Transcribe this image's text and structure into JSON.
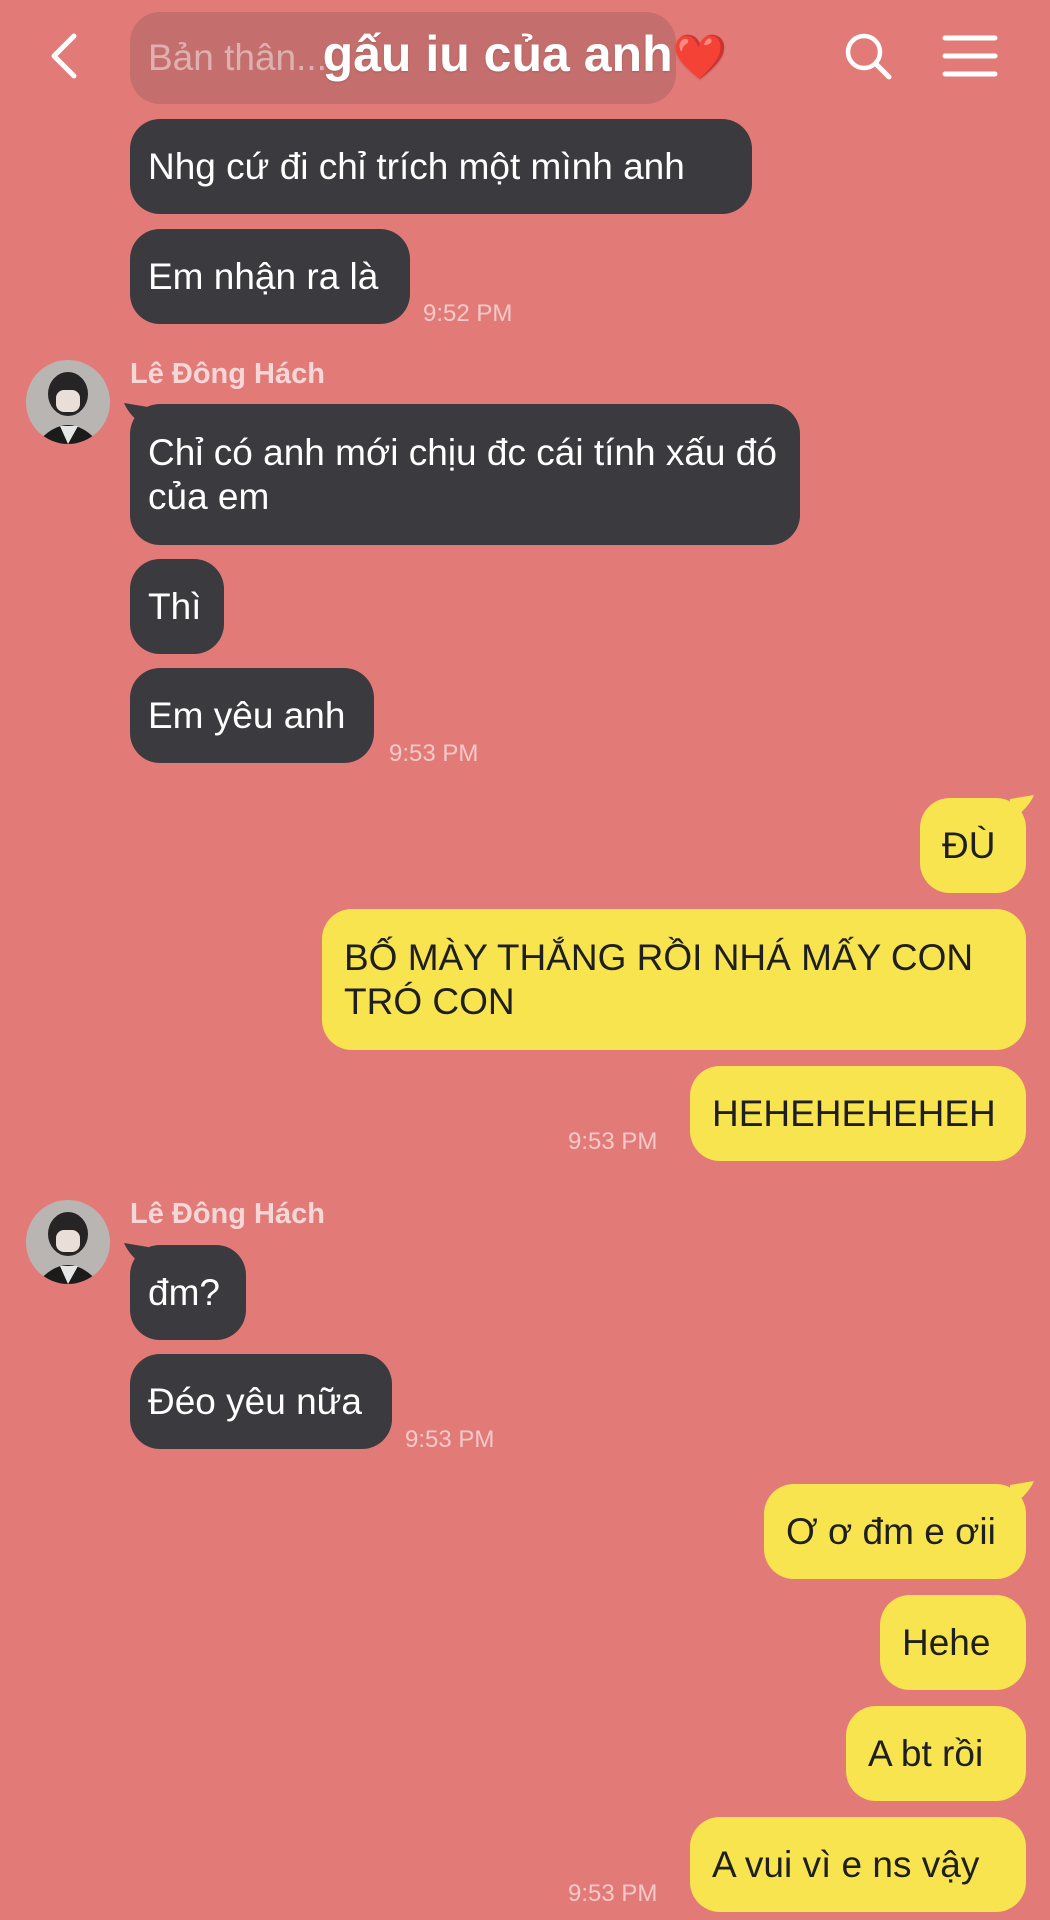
{
  "header": {
    "title": "gấu iu của anh",
    "title_emoji": "❤️"
  },
  "icons": {
    "back": "chevron-left-icon",
    "search": "search-icon",
    "menu": "hamburger-menu-icon"
  },
  "colors": {
    "background": "#e27b78",
    "incoming_bubble": "#3b3b3f",
    "outgoing_bubble": "#f8e44f"
  },
  "messages": [
    {
      "dir": "in",
      "text": "Bản thân..."
    },
    {
      "dir": "in",
      "text": "Nhg cứ đi chỉ trích một mình anh"
    },
    {
      "dir": "in",
      "text": "Em nhận ra là",
      "time": "9:52 PM"
    },
    {
      "dir": "in",
      "sender": "Lê Đông Hách",
      "text": "Chỉ có anh mới chịu đc cái tính xấu đó của em"
    },
    {
      "dir": "in",
      "text": "Thì"
    },
    {
      "dir": "in",
      "text": "Em yêu anh",
      "time": "9:53 PM"
    },
    {
      "dir": "out",
      "text": "ĐÙ"
    },
    {
      "dir": "out",
      "text": "BỐ MÀY THẮNG RỒI NHÁ MẤY CON TRÓ CON"
    },
    {
      "dir": "out",
      "text": "HEHEHEHEHEH",
      "time": "9:53 PM"
    },
    {
      "dir": "in",
      "sender": "Lê Đông Hách",
      "text": "đm?"
    },
    {
      "dir": "in",
      "text": "Đéo yêu nữa",
      "time": "9:53 PM"
    },
    {
      "dir": "out",
      "text": "Ơ ơ đm e ơii"
    },
    {
      "dir": "out",
      "text": "Hehe"
    },
    {
      "dir": "out",
      "text": "A bt rồi"
    },
    {
      "dir": "out",
      "text": "A vui vì e ns vậy",
      "time": "9:53 PM"
    }
  ]
}
